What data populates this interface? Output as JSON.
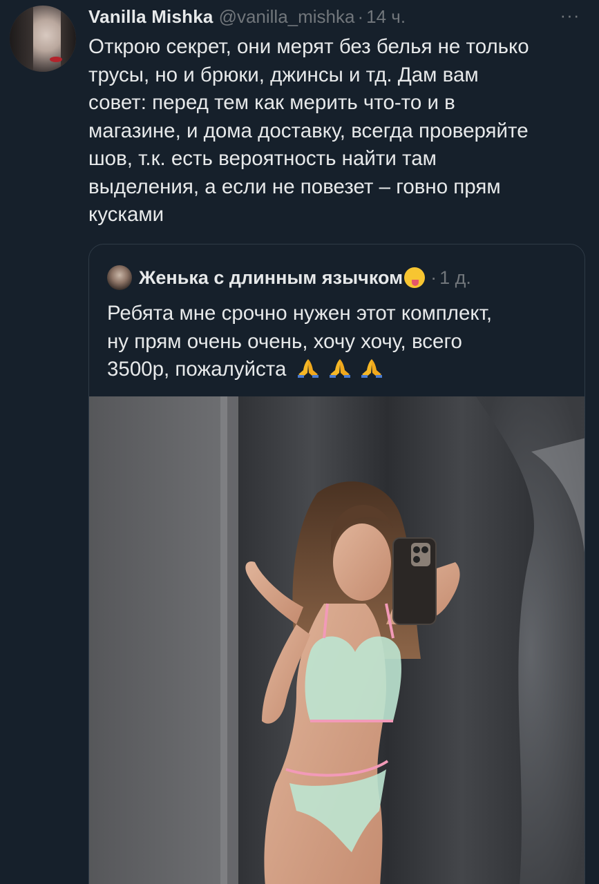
{
  "tweet": {
    "author_name": "Vanilla Mishka",
    "author_handle": "@vanilla_mishka",
    "separator": "·",
    "time": "14 ч.",
    "more_label": "···",
    "text_lines": [
      "Открою секрет, они мерят без белья не только",
      "трусы, но и брюки, джинсы и тд. Дам вам",
      "совет: перед тем как мерить что-то и в",
      "магазине, и дома доставку, всегда проверяйте",
      "шов, т.к. есть вероятность найти там",
      "выделения, а если не повезет – говно прям",
      "кусками"
    ]
  },
  "quoted_tweet": {
    "author_name": "Женька с длинным язычком",
    "emoji_icon": "face-with-tongue-icon",
    "separator": "·",
    "time": "1 д.",
    "text_lines": [
      "Ребята мне срочно нужен этот комплект,",
      "ну прям очень очень, хочу хочу, всего",
      "3500р, пожалуйста"
    ],
    "trailing_icons": [
      "folded-hands-icon",
      "folded-hands-icon",
      "folded-hands-icon"
    ]
  },
  "colors": {
    "background": "#16202b",
    "text_primary": "#e7e9ea",
    "text_secondary": "#71767b",
    "border": "#2f3b47"
  }
}
